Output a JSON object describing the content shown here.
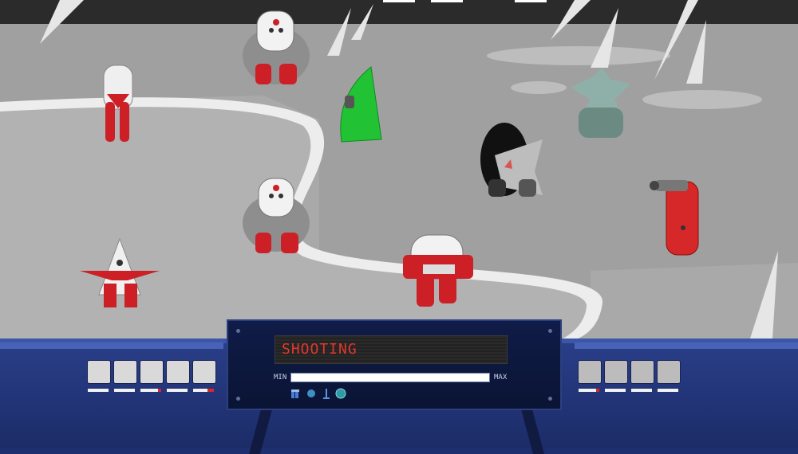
{
  "panel": {
    "status_text": "SHOOTING",
    "min_label": "MIN",
    "max_label": "MAX",
    "power_level": 1.0,
    "actions": [
      "ammo-icon",
      "orb-icon",
      "sniper-icon",
      "globe-icon"
    ]
  },
  "player_team": [
    {
      "name": "round-robot",
      "health": 1.0
    },
    {
      "name": "tall-robot",
      "health": 1.0
    },
    {
      "name": "cone-robot",
      "health": 0.85
    },
    {
      "name": "dome-robot",
      "health": 1.0
    },
    {
      "name": "visor-robot",
      "health": 0.7
    }
  ],
  "enemy_team": [
    {
      "name": "black-bomber",
      "health": 0.85
    },
    {
      "name": "green-spike",
      "health": 1.0
    },
    {
      "name": "spiky-plant",
      "health": 1.0
    },
    {
      "name": "red-antenna",
      "health": 1.0
    }
  ],
  "colors": {
    "ally_red": "#cc1f26",
    "enemy_green": "#22c235",
    "ui_blue": "#22357a",
    "display_text": "#e0372f"
  }
}
